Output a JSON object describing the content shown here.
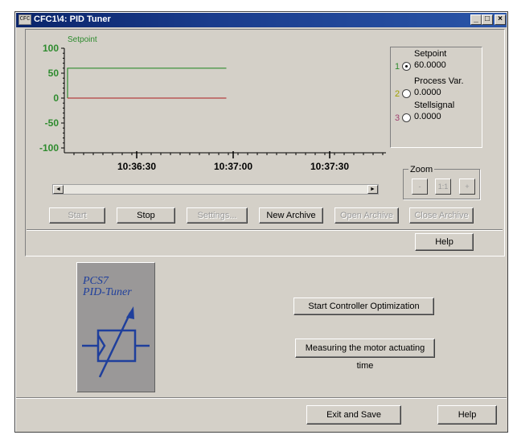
{
  "window": {
    "title": "CFC1\\4: PID Tuner",
    "icon_label": "CFC",
    "controls": [
      "_",
      "□",
      "×"
    ]
  },
  "chart_data": {
    "type": "line",
    "series_label": "Setpoint",
    "ylim": [
      -100,
      100
    ],
    "y_ticks": [
      "100",
      "50",
      "0",
      "-50",
      "-100"
    ],
    "x_ticks": [
      "10:36:30",
      "10:37:00",
      "10:37:30"
    ],
    "series": [
      {
        "name": "Setpoint",
        "color": "#2e8b2e",
        "points": [
          [
            0,
            0
          ],
          [
            0,
            60
          ],
          [
            50,
            60
          ]
        ]
      },
      {
        "name": "Process Var.",
        "color": "#b34040",
        "points": [
          [
            0,
            0
          ],
          [
            50,
            0
          ]
        ]
      }
    ]
  },
  "legend": [
    {
      "num": "1",
      "name": "Setpoint",
      "value": "60.0000",
      "selected": true,
      "num_color": "#2e8b2e"
    },
    {
      "num": "2",
      "name": "Process Var.",
      "value": "0.0000",
      "selected": false,
      "num_color": "#a0a000"
    },
    {
      "num": "3",
      "name": "Stellsignal",
      "value": "0.0000",
      "selected": false,
      "num_color": "#a04070"
    }
  ],
  "scrollbar": {
    "left_arrow": "◄",
    "right_arrow": "►"
  },
  "zoom": {
    "title": "Zoom",
    "buttons": [
      "-",
      "1:1",
      "+"
    ]
  },
  "toolbar": {
    "start": "Start",
    "stop": "Stop",
    "settings": "Settings...",
    "new_archive": "New Archive",
    "open_archive": "Open Archive",
    "close_archive": "Close Archive"
  },
  "help_label": "Help",
  "logo": {
    "line1": "PCS7",
    "line2": "PID-Tuner"
  },
  "actions": {
    "start_optimization": "Start Controller Optimization",
    "measure_motor": "Measuring the motor actuating time"
  },
  "footer": {
    "exit_save": "Exit and Save",
    "help": "Help"
  }
}
